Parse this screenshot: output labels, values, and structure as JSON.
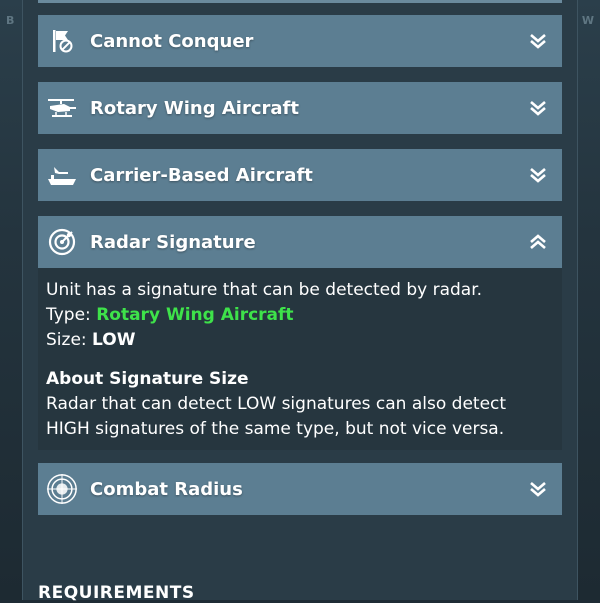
{
  "side_labels": {
    "left": "B",
    "right": "W"
  },
  "accordion": [
    {
      "id": "cannot-conquer",
      "label": "Cannot Conquer",
      "icon": "flag-no-icon",
      "expanded": false
    },
    {
      "id": "rotary-wing",
      "label": "Rotary Wing Aircraft",
      "icon": "helicopter-icon",
      "expanded": false
    },
    {
      "id": "carrier-based",
      "label": "Carrier-Based Aircraft",
      "icon": "carrier-icon",
      "expanded": false
    },
    {
      "id": "radar-signature",
      "label": "Radar Signature",
      "icon": "radar-icon",
      "expanded": true
    },
    {
      "id": "combat-radius",
      "label": "Combat Radius",
      "icon": "target-icon",
      "expanded": false
    }
  ],
  "radar_details": {
    "description": "Unit has a signature that can be detected by radar.",
    "type_label": "Type: ",
    "type_value": "Rotary Wing Aircraft",
    "size_label": "Size: ",
    "size_value": "LOW",
    "about_title": "About Signature Size",
    "about_line1": "Radar that can detect LOW signatures can also detect",
    "about_line2": "HIGH signatures of the same type, but not vice versa."
  },
  "section_heading": "REQUIREMENTS",
  "colors": {
    "header_bg": "#5c7e92",
    "body_bg": "#26363f",
    "highlight": "#3ee24a"
  }
}
